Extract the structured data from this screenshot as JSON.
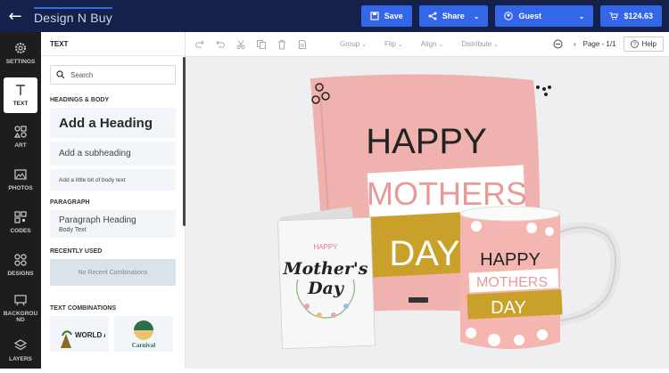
{
  "topbar": {
    "logo_text": "Design N Buy",
    "save": "Save",
    "share": "Share",
    "guest": "Guest",
    "cart": "$124.63"
  },
  "nav": [
    {
      "id": "settings",
      "label": "SETTINGS"
    },
    {
      "id": "text",
      "label": "TEXT"
    },
    {
      "id": "art",
      "label": "ART"
    },
    {
      "id": "photos",
      "label": "PHOTOS"
    },
    {
      "id": "codes",
      "label": "CODES"
    },
    {
      "id": "designs",
      "label": "DESIGNS"
    },
    {
      "id": "background",
      "label": "BACKGROU ND"
    },
    {
      "id": "layers",
      "label": "LAYERS"
    }
  ],
  "panel": {
    "title": "TEXT",
    "search_placeholder": "Search",
    "headings_section": "HEADINGS & BODY",
    "heading": "Add a Heading",
    "subheading": "Add a subheading",
    "body": "Add a little bit of body text",
    "paragraph_section": "PARAGRAPH",
    "paragraph_heading": "Paragraph Heading",
    "paragraph_body": "Body Text",
    "recent_section": "RECENTLY USED",
    "recent_empty": "No Recent Combinations",
    "combos_section": "TEXT COMBINATIONS",
    "combo1": "WORLD ADVENTURE",
    "combo2": "Carnival"
  },
  "toolbar": {
    "group": "Group",
    "flip": "Flip",
    "align": "Align",
    "distribute": "Distribute",
    "page": "Page - 1/1",
    "help": "Help"
  },
  "canvas": {
    "pillow_line1": "HAPPY",
    "pillow_line2": "MOTHERS",
    "pillow_line3": "DAY",
    "card_small": "HAPPY",
    "card_script1": "Mother's",
    "card_script2": "Day",
    "mug_line1": "HAPPY",
    "mug_line2": "MOTHERS",
    "mug_line3": "DAY"
  }
}
